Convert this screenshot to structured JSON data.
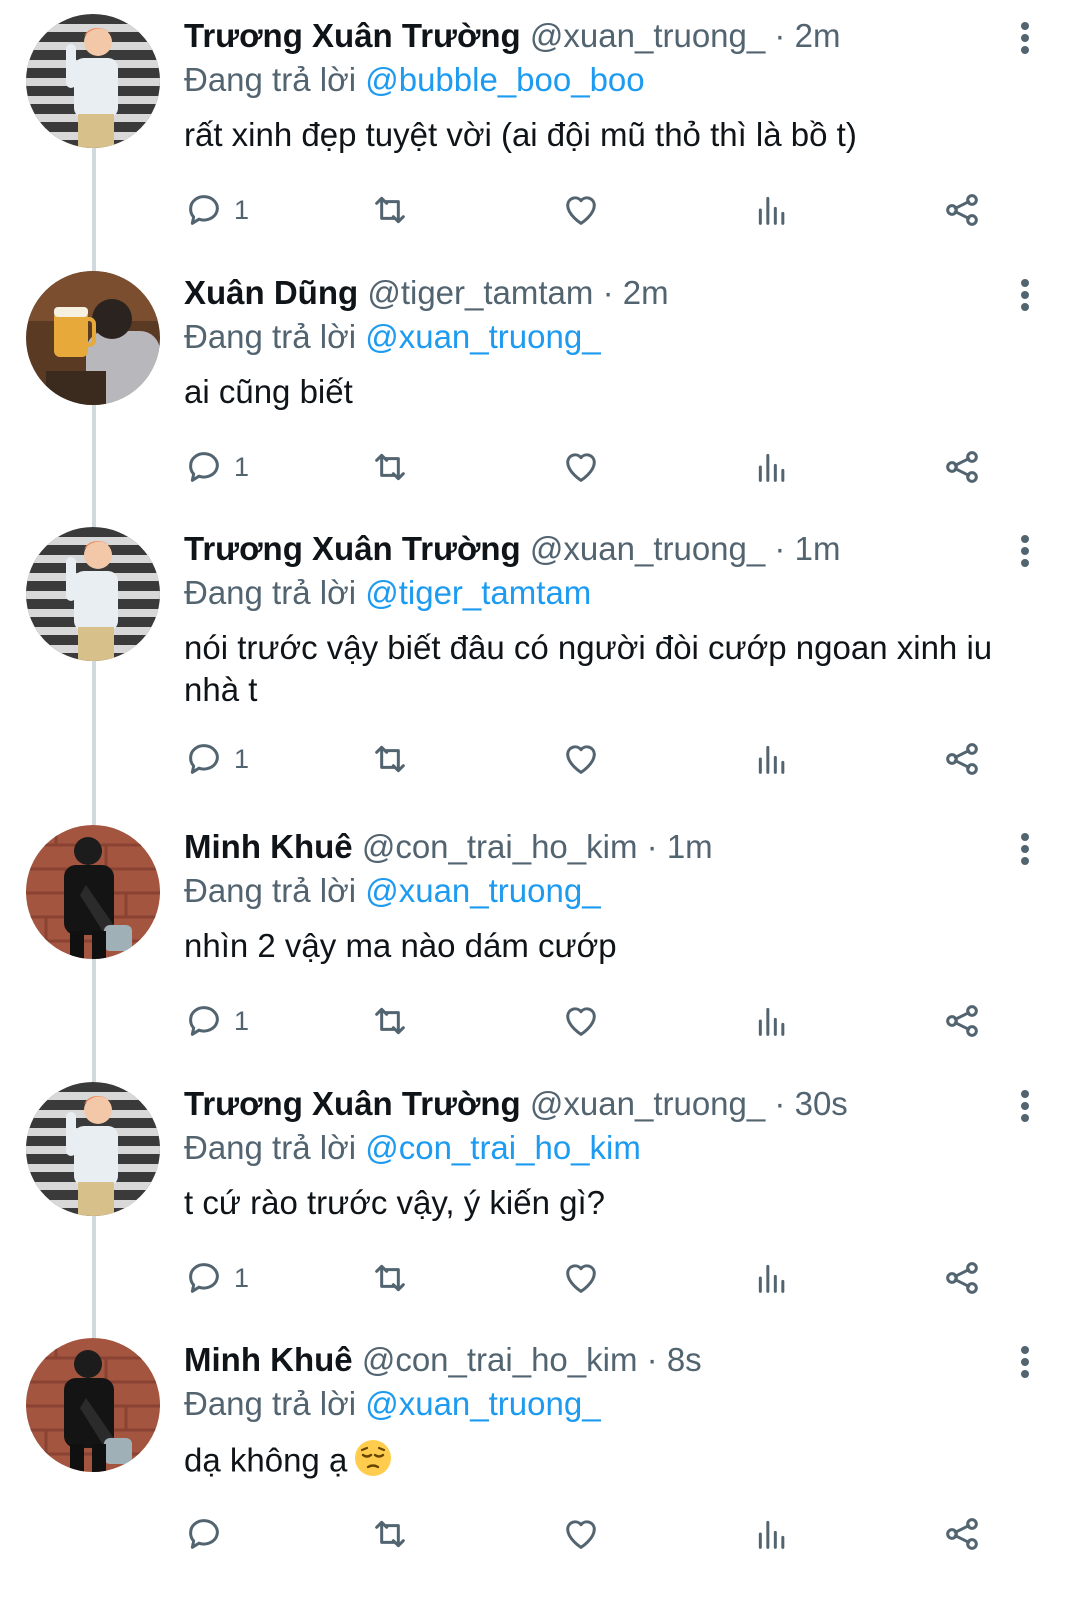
{
  "colors": {
    "text": "#0f1419",
    "secondary": "#536471",
    "link": "#1d9bf0",
    "connector": "#cfd9de"
  },
  "tweets": [
    {
      "name": "Trương Xuân Trường",
      "handle": "@xuan_truong_",
      "dot": "·",
      "time": "2m",
      "replying_prefix": "Đang trả lời",
      "replying_to": "@bubble_boo_boo",
      "text": "rất xinh đẹp tuyệt vời (ai đội mũ thỏ thì là bồ t)",
      "reply_count": "1",
      "avatar": "truong"
    },
    {
      "name": "Xuân Dũng",
      "handle": "@tiger_tamtam",
      "dot": "·",
      "time": "2m",
      "replying_prefix": "Đang trả lời",
      "replying_to": "@xuan_truong_",
      "text": "ai cũng biết",
      "reply_count": "1",
      "avatar": "dung"
    },
    {
      "name": "Trương Xuân Trường",
      "handle": "@xuan_truong_",
      "dot": "·",
      "time": "1m",
      "replying_prefix": "Đang trả lời",
      "replying_to": "@tiger_tamtam",
      "text": "nói trước vậy biết đâu có người đòi cướp ngoan xinh iu nhà t",
      "reply_count": "1",
      "avatar": "truong"
    },
    {
      "name": "Minh Khuê",
      "handle": "@con_trai_ho_kim",
      "dot": "·",
      "time": "1m",
      "replying_prefix": "Đang trả lời",
      "replying_to": "@xuan_truong_",
      "text": "nhìn 2 vậy ma nào dám cướp",
      "reply_count": "1",
      "avatar": "khue"
    },
    {
      "name": "Trương Xuân Trường",
      "handle": "@xuan_truong_",
      "dot": "·",
      "time": "30s",
      "replying_prefix": "Đang trả lời",
      "replying_to": "@con_trai_ho_kim",
      "text": "t cứ rào trước vậy, ý kiến gì?",
      "reply_count": "1",
      "avatar": "truong"
    },
    {
      "name": "Minh Khuê",
      "handle": "@con_trai_ho_kim",
      "dot": "·",
      "time": "8s",
      "replying_prefix": "Đang trả lời",
      "replying_to": "@xuan_truong_",
      "text": "dạ không ạ",
      "reply_count": "",
      "avatar": "khue",
      "emoji": "pensive-face"
    }
  ]
}
